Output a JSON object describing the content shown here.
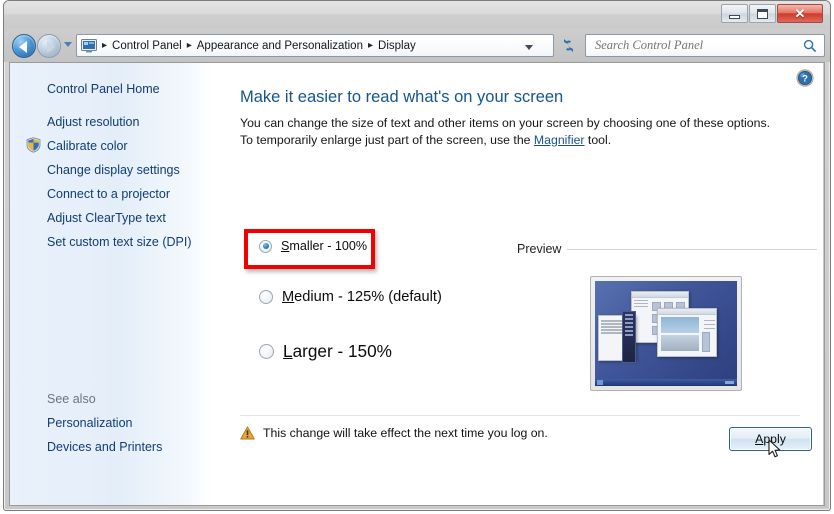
{
  "window": {
    "controls": {
      "minimize": "Minimize",
      "maximize": "Maximize",
      "close": "Close",
      "close_glyph": "✕"
    }
  },
  "toolbar": {
    "back_tooltip": "Back",
    "forward_tooltip": "Forward",
    "history_tooltip": "Recent pages",
    "breadcrumb": [
      "Control Panel",
      "Appearance and Personalization",
      "Display"
    ],
    "breadcrumb_separator": "▸",
    "refresh_tooltip": "Refresh",
    "address_dropdown": "Previous locations"
  },
  "search": {
    "placeholder": "Search Control Panel",
    "value": "",
    "icon": "search-icon"
  },
  "sidebar": {
    "home_label": "Control Panel Home",
    "items": [
      {
        "label": "Adjust resolution",
        "shield": false
      },
      {
        "label": "Calibrate color",
        "shield": true
      },
      {
        "label": "Change display settings",
        "shield": false
      },
      {
        "label": "Connect to a projector",
        "shield": false
      },
      {
        "label": "Adjust ClearType text",
        "shield": false
      },
      {
        "label": "Set custom text size (DPI)",
        "shield": false
      }
    ],
    "see_also_label": "See also",
    "see_also_items": [
      {
        "label": "Personalization"
      },
      {
        "label": "Devices and Printers"
      }
    ]
  },
  "content": {
    "help_icon": "help-icon",
    "title": "Make it easier to read what's on your screen",
    "description_part1": "You can change the size of text and other items on your screen by choosing one of these options. To temporarily enlarge just part of the screen, use the ",
    "description_link": "Magnifier",
    "description_part2": " tool.",
    "options": [
      {
        "accel": "S",
        "rest": "maller - 100%",
        "checked": true
      },
      {
        "accel": "M",
        "rest": "edium - 125% (default)",
        "checked": false
      },
      {
        "accel": "L",
        "rest": "arger - 150%",
        "checked": false
      }
    ],
    "preview_label": "Preview",
    "warning_text": "This change will take effect the next time you log on.",
    "warning_icon": "warning-triangle-icon",
    "apply_accel": "A",
    "apply_rest": "pply"
  },
  "colors": {
    "accent": "#16558e",
    "link": "#123c75",
    "highlight": "#f40000",
    "warning": "#e8a33d"
  }
}
